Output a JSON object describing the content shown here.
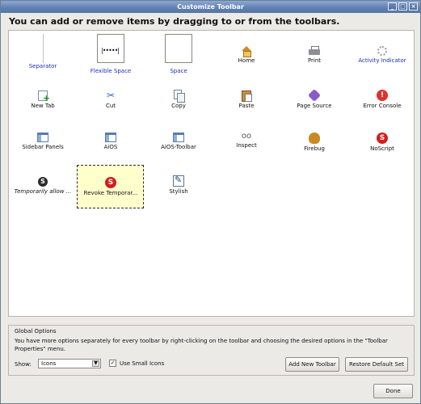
{
  "window": {
    "title": "Customize Toolbar"
  },
  "heading": "You can add or remove items by dragging to or from the toolbars.",
  "palette": {
    "items": [
      {
        "label": "Separator",
        "icon": "separator-line"
      },
      {
        "label": "Flexible Space",
        "icon": "flexible-space-icon"
      },
      {
        "label": "Space",
        "icon": "space-box-icon"
      },
      {
        "label": "Home",
        "icon": "home-icon"
      },
      {
        "label": "Print",
        "icon": "printer-icon"
      },
      {
        "label": "Activity Indicator",
        "icon": "throbber-icon"
      },
      {
        "label": "New Tab",
        "icon": "new-tab-icon"
      },
      {
        "label": "Cut",
        "icon": "scissors-icon"
      },
      {
        "label": "Copy",
        "icon": "copy-icon"
      },
      {
        "label": "Paste",
        "icon": "clipboard-icon"
      },
      {
        "label": "Page Source",
        "icon": "code-icon"
      },
      {
        "label": "Error Console",
        "icon": "error-icon"
      },
      {
        "label": "Sidebar Panels",
        "icon": "sidebar-icon"
      },
      {
        "label": "AiOS",
        "icon": "panel-icon"
      },
      {
        "label": "AiOS-Toolbar",
        "icon": "panel-icon"
      },
      {
        "label": "Inspect",
        "icon": "glasses-icon"
      },
      {
        "label": "Firebug",
        "icon": "bug-icon"
      },
      {
        "label": "NoScript",
        "icon": "noscript-icon"
      },
      {
        "label": "Temporarily allow ...",
        "icon": "noscript-temp-icon"
      },
      {
        "label": "Revoke Temporar...",
        "icon": "noscript-revoke-icon"
      },
      {
        "label": "Stylish",
        "icon": "stylish-icon"
      }
    ]
  },
  "global": {
    "title": "Global Options",
    "description": "You have more options separately for every toolbar by right-clicking on the toolbar and choosing the desired options in the \"Toolbar Properties\" menu.",
    "show_label": "Show:",
    "show_value": "Icons",
    "small_icons_label": "Use Small Icons",
    "small_icons_checked": true,
    "add_button": "Add New Toolbar",
    "restore_button": "Restore Default Set"
  },
  "done_button": "Done"
}
